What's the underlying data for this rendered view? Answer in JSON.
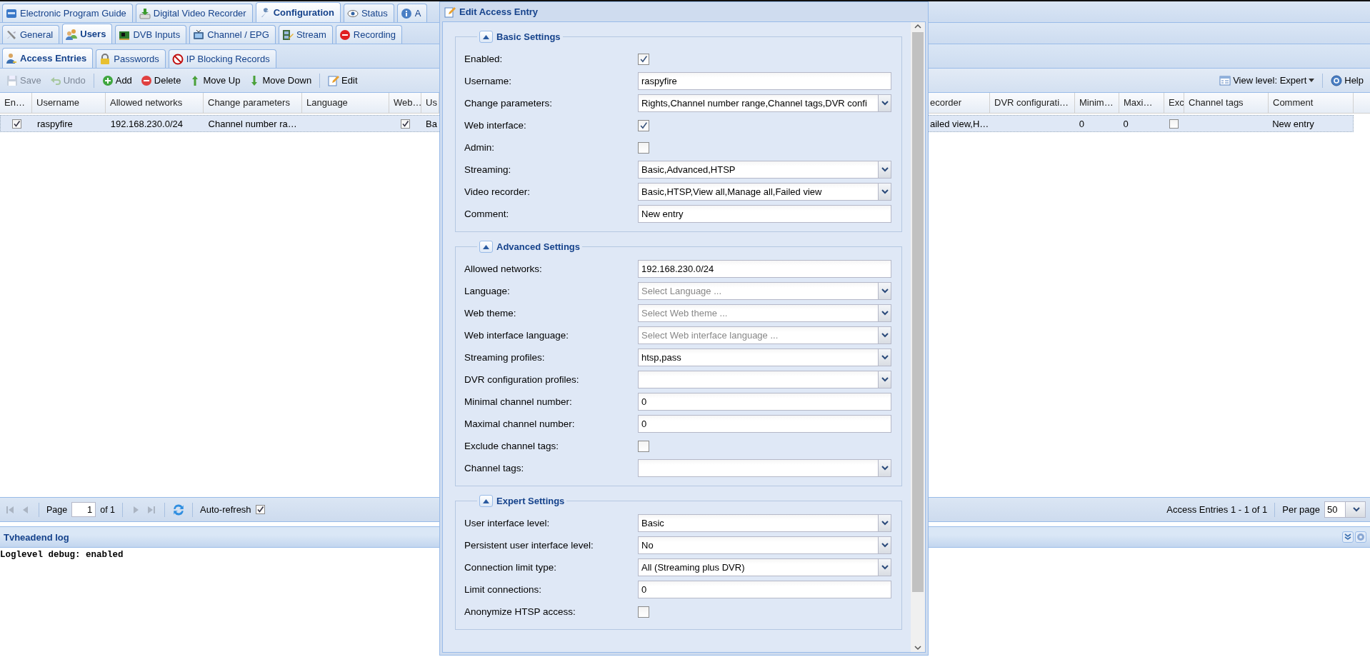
{
  "tab_rows": [
    [
      {
        "label": "Electronic Program Guide",
        "selected": false
      },
      {
        "label": "Digital Video Recorder",
        "selected": false
      },
      {
        "label": "Configuration",
        "selected": true
      },
      {
        "label": "Status",
        "selected": false
      },
      {
        "label": "A",
        "selected": false
      }
    ],
    [
      {
        "label": "General",
        "selected": false
      },
      {
        "label": "Users",
        "selected": true
      },
      {
        "label": "DVB Inputs",
        "selected": false
      },
      {
        "label": "Channel / EPG",
        "selected": false
      },
      {
        "label": "Stream",
        "selected": false
      },
      {
        "label": "Recording",
        "selected": false
      }
    ],
    [
      {
        "label": "Access Entries",
        "selected": true
      },
      {
        "label": "Passwords",
        "selected": false
      },
      {
        "label": "IP Blocking Records",
        "selected": false
      }
    ]
  ],
  "toolbar": {
    "groups": [
      [
        {
          "label": "Save",
          "disabled": true
        },
        {
          "label": "Undo",
          "disabled": true
        }
      ],
      [
        {
          "label": "Add",
          "disabled": false
        },
        {
          "label": "Delete",
          "disabled": false
        },
        {
          "label": "Move Up",
          "disabled": false
        },
        {
          "label": "Move Down",
          "disabled": false
        }
      ],
      [
        {
          "label": "Edit",
          "disabled": false
        }
      ]
    ],
    "view_level": "View level: Expert",
    "help": "Help"
  },
  "grid": {
    "columns": [
      "En…",
      "Username",
      "Allowed networks",
      "Change parameters",
      "Language",
      "Web…",
      "Us",
      "ecorder",
      "DVR configurati…",
      "Minim…",
      "Maxi…",
      "Exc",
      "Channel tags",
      "Comment"
    ],
    "rows": [
      {
        "selected": true,
        "cells": [
          {
            "kind": "check",
            "checked": true
          },
          {
            "kind": "text",
            "text": "raspyfire"
          },
          {
            "kind": "text",
            "text": "192.168.230.0/24"
          },
          {
            "kind": "text",
            "text": "Channel number ra…"
          },
          {
            "kind": "text"
          },
          {
            "kind": "check",
            "checked": true
          },
          {
            "kind": "text",
            "text": "Ba"
          },
          {
            "kind": "text",
            "text": "ailed view,H…"
          },
          {
            "kind": "text"
          },
          {
            "kind": "text",
            "text": "0"
          },
          {
            "kind": "text",
            "text": "0"
          },
          {
            "kind": "check",
            "checked": false
          },
          {
            "kind": "text"
          },
          {
            "kind": "text",
            "text": "New entry"
          }
        ]
      }
    ]
  },
  "paging": {
    "page_label": "Page",
    "page": "1",
    "of": "of 1",
    "auto_refresh": {
      "label": "Auto-refresh",
      "checked": true
    },
    "summary": "Access Entries 1 - 1 of 1",
    "per_page_label": "Per page",
    "per_page": "50"
  },
  "log": {
    "title": "Tvheadend log",
    "lines": [
      "Loglevel debug: enabled"
    ]
  },
  "dialog": {
    "title": "Edit Access Entry",
    "fieldsets": [
      {
        "legend": "Basic Settings",
        "expanded": true,
        "fields": [
          {
            "label": "Enabled:",
            "kind": "check",
            "checked": true
          },
          {
            "label": "Username:",
            "kind": "text",
            "value": "raspyfire"
          },
          {
            "label": "Change parameters:",
            "kind": "combo",
            "value": "Rights,Channel number range,Channel tags,DVR confi"
          },
          {
            "label": "Web interface:",
            "kind": "check",
            "checked": true
          },
          {
            "label": "Admin:",
            "kind": "check",
            "checked": false
          },
          {
            "label": "Streaming:",
            "kind": "combo",
            "value": "Basic,Advanced,HTSP"
          },
          {
            "label": "Video recorder:",
            "kind": "combo",
            "value": "Basic,HTSP,View all,Manage all,Failed view"
          },
          {
            "label": "Comment:",
            "kind": "text",
            "value": "New entry"
          }
        ]
      },
      {
        "legend": "Advanced Settings",
        "expanded": true,
        "fields": [
          {
            "label": "Allowed networks:",
            "kind": "text",
            "value": "192.168.230.0/24"
          },
          {
            "label": "Language:",
            "kind": "combo",
            "placeholder": "Select Language ..."
          },
          {
            "label": "Web theme:",
            "kind": "combo",
            "placeholder": "Select Web theme ..."
          },
          {
            "label": "Web interface language:",
            "kind": "combo",
            "placeholder": "Select Web interface language ..."
          },
          {
            "label": "Streaming profiles:",
            "kind": "combo",
            "value": "htsp,pass"
          },
          {
            "label": "DVR configuration profiles:",
            "kind": "combo"
          },
          {
            "label": "Minimal channel number:",
            "kind": "text",
            "value": "0"
          },
          {
            "label": "Maximal channel number:",
            "kind": "text",
            "value": "0"
          },
          {
            "label": "Exclude channel tags:",
            "kind": "check",
            "checked": false
          },
          {
            "label": "Channel tags:",
            "kind": "combo"
          }
        ]
      },
      {
        "legend": "Expert Settings",
        "expanded": true,
        "fields": [
          {
            "label": "User interface level:",
            "kind": "combo",
            "value": "Basic"
          },
          {
            "label": "Persistent user interface level:",
            "kind": "combo",
            "value": "No"
          },
          {
            "label": "Connection limit type:",
            "kind": "combo",
            "value": "All (Streaming plus DVR)"
          },
          {
            "label": "Limit connections:",
            "kind": "text",
            "value": "0"
          },
          {
            "label": "Anonymize HTSP access:",
            "kind": "check",
            "checked": false
          }
        ]
      }
    ]
  }
}
